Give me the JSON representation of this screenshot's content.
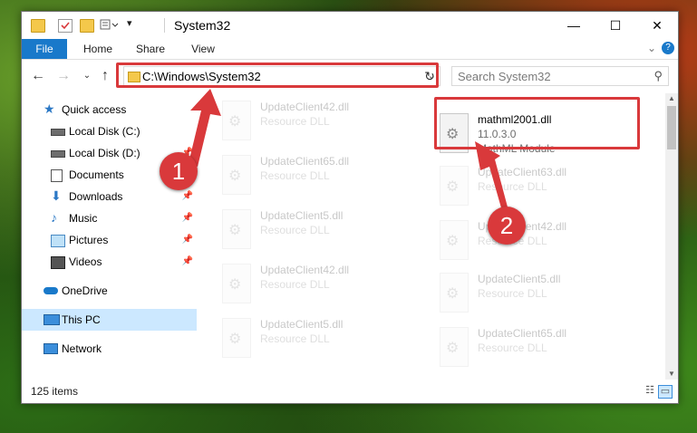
{
  "window": {
    "title": "System32",
    "controls": {
      "minimize": "—",
      "maximize": "☐",
      "close": "✕"
    }
  },
  "ribbon": {
    "tabs": [
      "File",
      "Home",
      "Share",
      "View"
    ],
    "expand_icon": "chevron-down-icon",
    "help_icon": "help-icon"
  },
  "navbar": {
    "address": "C:\\Windows\\System32",
    "search_placeholder": "Search System32"
  },
  "sidebar": {
    "items": [
      {
        "label": "Quick access",
        "icon": "star-icon",
        "pinned": false
      },
      {
        "label": "Local Disk (C:)",
        "icon": "drive-icon",
        "pinned": true
      },
      {
        "label": "Local Disk (D:)",
        "icon": "drive-icon",
        "pinned": true
      },
      {
        "label": "Documents",
        "icon": "documents-icon",
        "pinned": true
      },
      {
        "label": "Downloads",
        "icon": "download-icon",
        "pinned": true
      },
      {
        "label": "Music",
        "icon": "music-icon",
        "pinned": true
      },
      {
        "label": "Pictures",
        "icon": "pictures-icon",
        "pinned": true
      },
      {
        "label": "Videos",
        "icon": "videos-icon",
        "pinned": true
      },
      {
        "label": "OneDrive",
        "icon": "cloud-icon",
        "pinned": false
      },
      {
        "label": "This PC",
        "icon": "computer-icon",
        "pinned": false,
        "selected": true
      },
      {
        "label": "Network",
        "icon": "network-icon",
        "pinned": false
      }
    ]
  },
  "files": {
    "highlighted": {
      "name": "mathml2001.dll",
      "version": "11.0.3.0",
      "description": "MathML Module"
    },
    "left_column": [
      {
        "name": "UpdateClient42.dll",
        "type": "Resource DLL"
      },
      {
        "name": "UpdateClient65.dll",
        "type": "Resource DLL"
      },
      {
        "name": "UpdateClient5.dll",
        "type": "Resource DLL"
      },
      {
        "name": "UpdateClient42.dll",
        "type": "Resource DLL"
      },
      {
        "name": "UpdateClient5.dll",
        "type": "Resource DLL"
      }
    ],
    "right_column": [
      {
        "name": "UpdateClient63.dll",
        "type": "Resource DLL"
      },
      {
        "name": "UpdateClient42.dll",
        "type": "Resource DLL"
      },
      {
        "name": "UpdateClient5.dll",
        "type": "Resource DLL"
      },
      {
        "name": "UpdateClient65.dll",
        "type": "Resource DLL"
      }
    ]
  },
  "status": {
    "item_count": "125 items"
  },
  "annotations": {
    "step1": "1",
    "step2": "2",
    "color": "#d9393b"
  }
}
